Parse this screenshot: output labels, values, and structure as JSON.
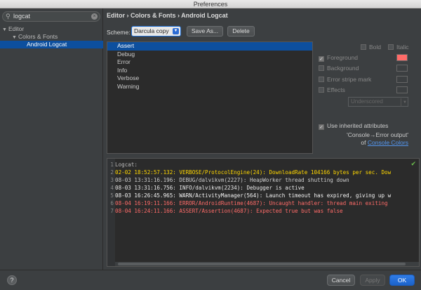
{
  "window": {
    "title": "Preferences"
  },
  "sidebar": {
    "search": {
      "value": "logcat"
    },
    "tree": [
      {
        "label": "Editor",
        "expanded": true,
        "selected": false
      },
      {
        "label": "Colors & Fonts",
        "expanded": true,
        "selected": false
      },
      {
        "label": "Android Logcat",
        "selected": true
      }
    ]
  },
  "main": {
    "breadcrumb": "Editor › Colors & Fonts › Android Logcat",
    "scheme_label": "Scheme:",
    "scheme_value": "Darcula copy",
    "save_as_label": "Save As...",
    "delete_label": "Delete",
    "levels": [
      "Assert",
      "Debug",
      "Error",
      "Info",
      "Verbose",
      "Warning"
    ],
    "selected_level": "Assert",
    "options": {
      "bold": {
        "label": "Bold",
        "checked": false
      },
      "italic": {
        "label": "Italic",
        "checked": false
      },
      "foreground": {
        "label": "Foreground",
        "checked": true,
        "color": "#ff6b68"
      },
      "background": {
        "label": "Background",
        "checked": false
      },
      "error_stripe": {
        "label": "Error stripe mark",
        "checked": false
      },
      "effects": {
        "label": "Effects",
        "checked": false
      },
      "effect_type": "Underscored"
    },
    "inherit": {
      "label": "Use inherited attributes",
      "checked": true,
      "source_line1": "'Console→Error output'",
      "source_prefix": "of",
      "source_link": "Console Colors"
    },
    "preview": [
      {
        "n": "1",
        "text": "Logcat:",
        "color": "#bbbbbb"
      },
      {
        "n": "2",
        "text": "02-02 18:52:57.132: VERBOSE/ProtocolEngine(24): DownloadRate 104166 bytes per sec. Dow",
        "color": "#ffd700"
      },
      {
        "n": "3",
        "text": "08-03 13:31:16.196: DEBUG/dalvikvm(2227): HeapWorker thread shutting down",
        "color": "#cccccc"
      },
      {
        "n": "4",
        "text": "08-03 13:31:16.756: INFO/dalvikvm(2234): Debugger is active",
        "color": "#e8e8e8"
      },
      {
        "n": "5",
        "text": "08-03 16:26:45.965: WARN/ActivityManager(564): Launch timeout has expired, giving up w",
        "color": "#f5f5f5"
      },
      {
        "n": "6",
        "text": "08-04 16:19:11.166: ERROR/AndroidRuntime(4687): Uncaught handler: thread main exiting",
        "color": "#ff6b68"
      },
      {
        "n": "7",
        "text": "08-04 16:24:11.166: ASSERT/Assertion(4687): Expected true but was false",
        "color": "#ff6b68"
      }
    ]
  },
  "footer": {
    "help_label": "?",
    "cancel_label": "Cancel",
    "apply_label": "Apply",
    "ok_label": "OK"
  }
}
